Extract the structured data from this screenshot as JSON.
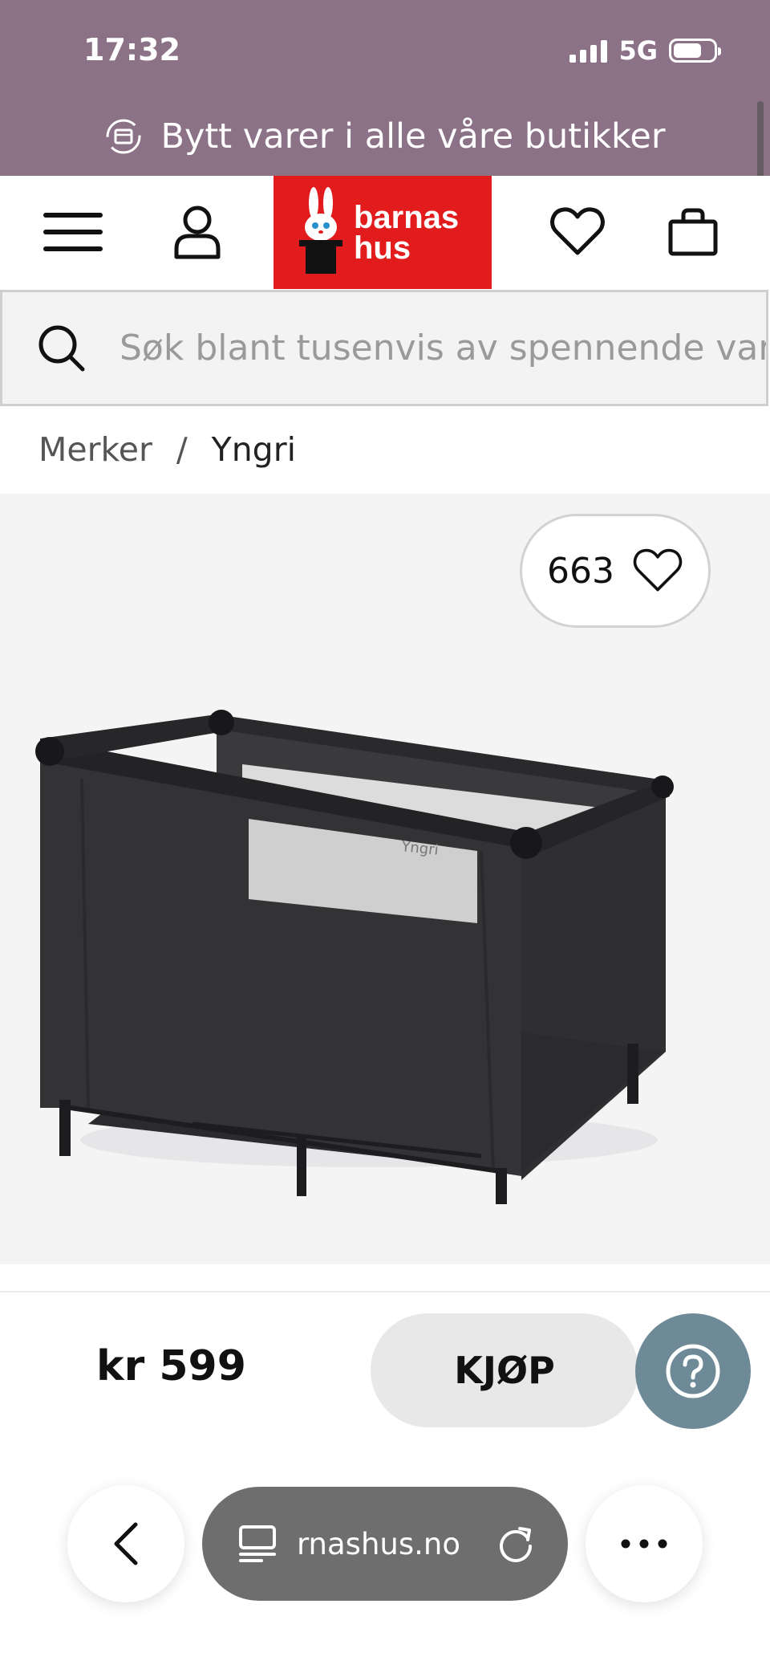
{
  "status_bar": {
    "time": "17:32",
    "network": "5G"
  },
  "banner": {
    "text": "Bytt varer i alle våre butikker",
    "icon": "exchange-icon"
  },
  "header": {
    "menu_icon": "hamburger-icon",
    "account_icon": "user-icon",
    "logo": {
      "line1": "barnas",
      "line2": "hus"
    },
    "wishlist_icon": "heart-icon",
    "cart_icon": "bag-icon"
  },
  "search": {
    "placeholder": "Søk blant tusenvis av spennende varer"
  },
  "breadcrumb": {
    "parent": "Merker",
    "separator": "/",
    "current": "Yngri"
  },
  "product": {
    "wishlist_count": "663",
    "brand_print": "Yngri"
  },
  "purchase": {
    "price": "kr 599",
    "buy_label": "KJØP"
  },
  "browser": {
    "url": "rnashus.no"
  },
  "colors": {
    "purple": "#8c7287",
    "brand_red": "#e21c1c",
    "help": "#6f8a97"
  }
}
